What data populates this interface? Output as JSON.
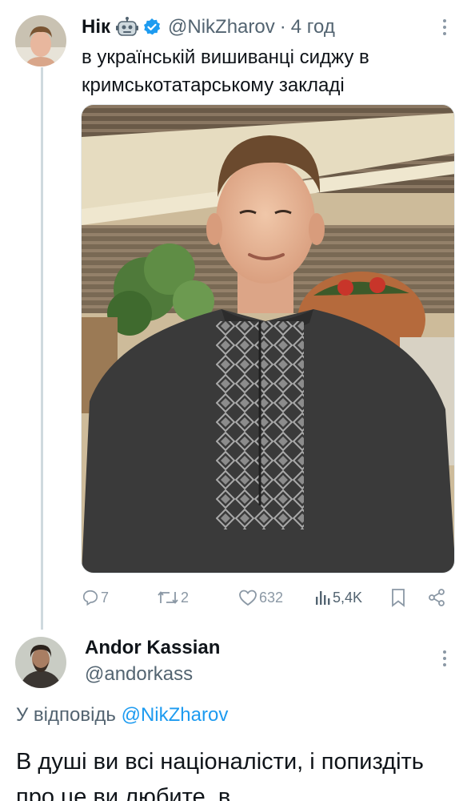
{
  "tweet": {
    "author": {
      "display_name": "Нік",
      "handle": "@NikZharov",
      "verified": true,
      "automated_badge": "robot-icon"
    },
    "separator": "·",
    "time": "4 год",
    "text": "в українській вишиванці сиджу в кримськотатарському закладі",
    "media": {
      "type": "photo",
      "alt": "selfie"
    },
    "actions": {
      "replies": "7",
      "retweets": "2",
      "likes": "632",
      "views": "5,4K"
    }
  },
  "reply": {
    "author": {
      "display_name": "Andor Kassian",
      "handle": "@andorkass"
    },
    "replying_to_prefix": "У відповідь",
    "replying_to_handle": "@NikZharov",
    "text": "В душі ви всі націоналісти, і попиздіть про це ви любите, в"
  },
  "colors": {
    "text_primary": "#0f1419",
    "text_secondary": "#536471",
    "link": "#1d9bf0",
    "icon_muted": "#8b98a5",
    "thread_line": "#cfd9de"
  }
}
